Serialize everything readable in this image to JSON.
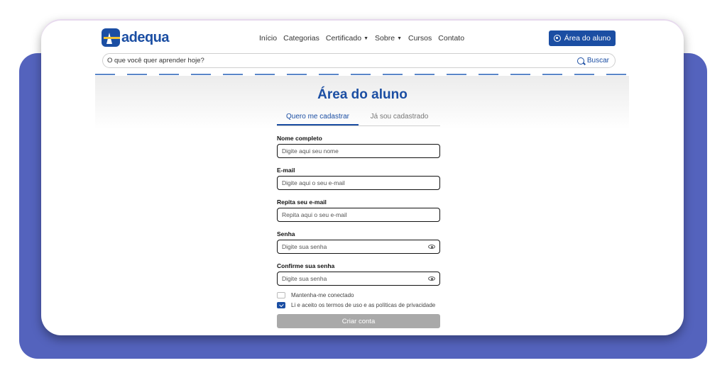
{
  "brand": {
    "name": "adequa",
    "primary_color": "#1b4ea3",
    "backdrop_color": "#5463bd"
  },
  "nav": [
    {
      "label": "Início",
      "dropdown": false
    },
    {
      "label": "Categorias",
      "dropdown": false
    },
    {
      "label": "Certificado",
      "dropdown": true
    },
    {
      "label": "Sobre",
      "dropdown": true
    },
    {
      "label": "Cursos",
      "dropdown": false
    },
    {
      "label": "Contato",
      "dropdown": false
    }
  ],
  "header": {
    "student_area_label": "Área do aluno",
    "user_icon": "user-circle-icon"
  },
  "search": {
    "placeholder": "O que você quer aprender hoje?",
    "button_label": "Buscar",
    "icon": "search-icon"
  },
  "page": {
    "title": "Área do aluno"
  },
  "tabs": [
    {
      "label": "Quero me cadastrar",
      "active": true
    },
    {
      "label": "Já sou cadastrado",
      "active": false
    }
  ],
  "form": {
    "fields": [
      {
        "label": "Nome completo",
        "placeholder": "Digite aqui seu nome",
        "password": false
      },
      {
        "label": "E-mail",
        "placeholder": "Digite aqui o seu e-mail",
        "password": false
      },
      {
        "label": "Repita seu e-mail",
        "placeholder": "Repita aqui o seu e-mail",
        "password": false
      },
      {
        "label": "Senha",
        "placeholder": "Digite sua senha",
        "password": true
      },
      {
        "label": "Confirme sua senha",
        "placeholder": "Digite sua senha",
        "password": true
      }
    ],
    "keep_connected_label": "Mantenha-me conectado",
    "keep_connected_checked": false,
    "terms_label": "Li e aceito os termos de uso e as políticas de privacidade",
    "terms_checked": true,
    "submit_label": "Criar conta",
    "submit_color": "#a9a9a9"
  }
}
